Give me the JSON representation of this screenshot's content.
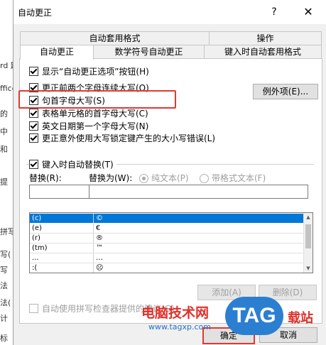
{
  "background_app": {
    "fragments": [
      "rd 题",
      "ffice",
      "的",
      "中",
      "和",
      "提",
      "拼写",
      "写(",
      "写",
      "法",
      "法(",
      "计",
      "标"
    ]
  },
  "dialog": {
    "title": "自动更正",
    "help_glyph": "?",
    "close_glyph": "✕"
  },
  "tabs": {
    "row_top": [
      "自动套用格式",
      "操作"
    ],
    "row_bottom": [
      "自动更正",
      "数学符号自动更正",
      "键入时自动套用格式"
    ],
    "active": "自动更正"
  },
  "options": {
    "show_buttons": "显示“自动更正选项”按钮(H)",
    "two_initial_caps": "更正前两个字母连续大写(O)",
    "first_letter_sentence": "句首字母大写(S)",
    "first_letter_table": "表格单元格的首字母大写(C)",
    "english_days": "英文日期第一个字母大写(N)",
    "caps_lock": "更正意外使用大写锁定键产生的大小写错误(L)",
    "exceptions_button": "例外项(E)..."
  },
  "replace": {
    "checkbox_label": "键入时自动替换(T)",
    "replace_label": "替换(R):",
    "with_label": "替换为(W):",
    "plain_text": "纯文本(P)",
    "formatted_text": "带格式文本(F)",
    "replace_value": "",
    "with_value": "",
    "entries": [
      {
        "from": "(c)",
        "to": "©"
      },
      {
        "from": "(e)",
        "to": "€"
      },
      {
        "from": "(r)",
        "to": "®"
      },
      {
        "from": "(tm)",
        "to": "™"
      },
      {
        "from": "...",
        "to": "…"
      },
      {
        "from": ":(",
        "to": "☹"
      }
    ],
    "add_button": "添加(A)",
    "delete_button": "删除(D)",
    "spellcheck_label": "自动使用拼写检查器提供的建议(G)"
  },
  "footer": {
    "ok": "确定",
    "cancel": "取消"
  },
  "watermark": {
    "text": "电脑技术网",
    "url": "www.tagxp.com",
    "logo": "TAG",
    "suffix": "载站"
  }
}
